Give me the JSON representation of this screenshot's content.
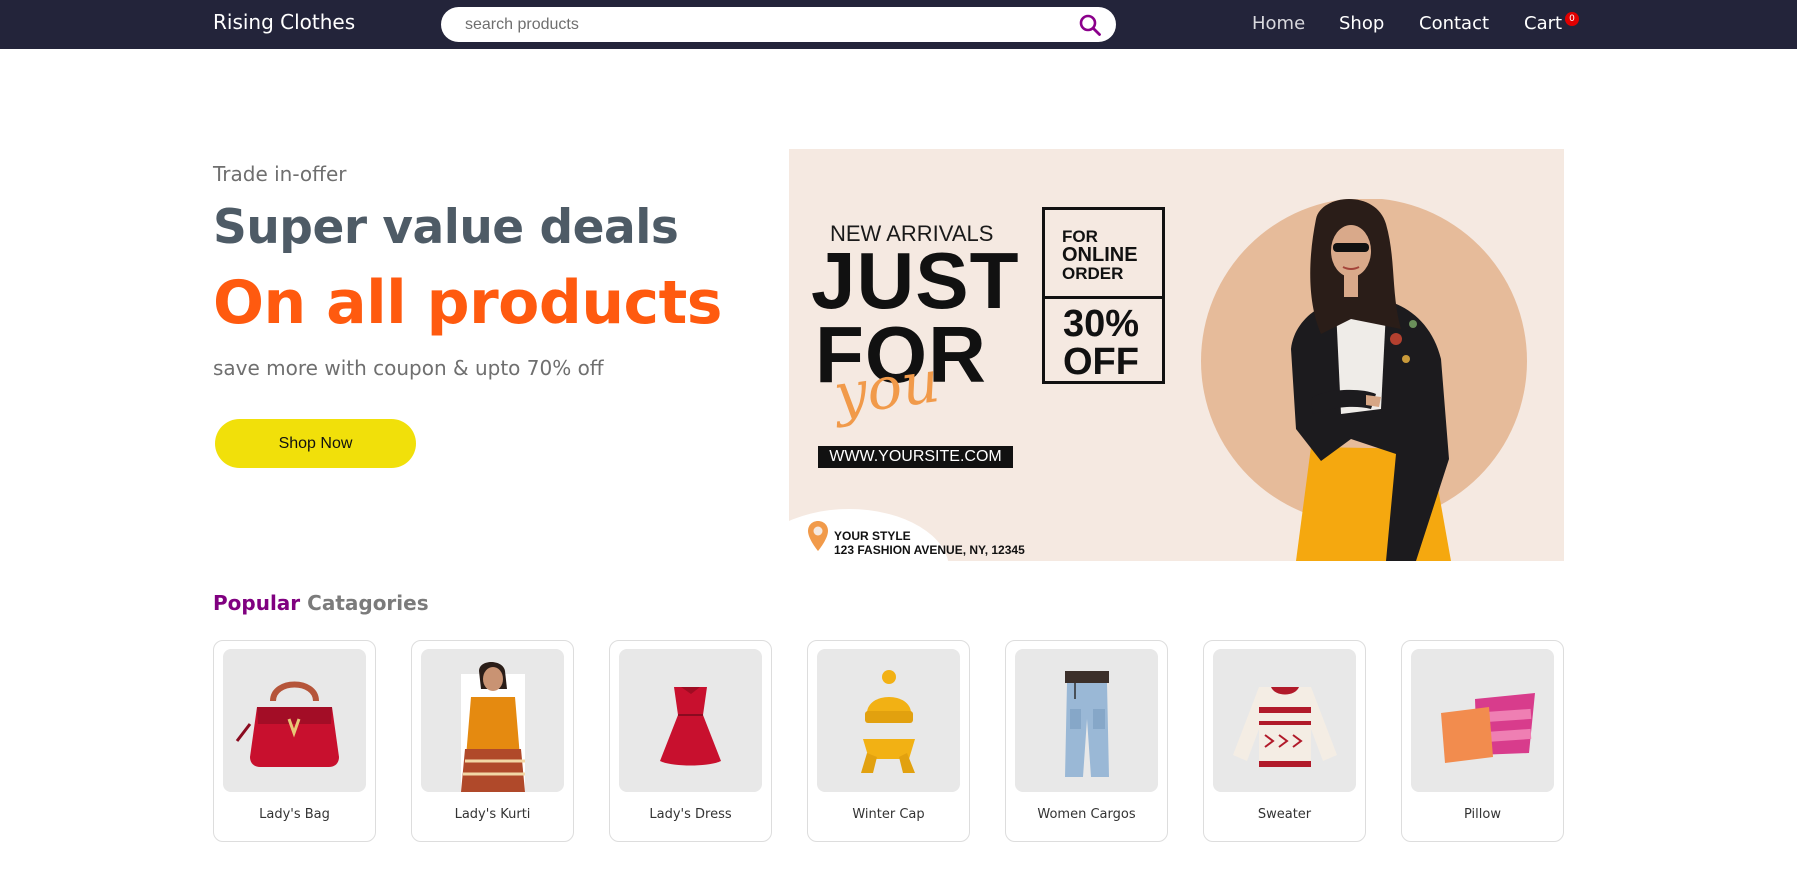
{
  "navbar": {
    "brand": "Rising Clothes",
    "search": {
      "placeholder": "search products",
      "value": ""
    },
    "links": [
      {
        "label": "Home"
      },
      {
        "label": "Shop"
      },
      {
        "label": "Contact"
      },
      {
        "label": "Cart"
      }
    ],
    "cart_count": "0"
  },
  "hero": {
    "kicker": "Trade in-offer",
    "title": "Super value deals",
    "title2": "On all products",
    "subtitle": "save more with coupon & upto 70% off",
    "cta_label": "Shop Now"
  },
  "banner": {
    "new_arrivals": "NEW ARRIVALS",
    "just": "JUST",
    "for": "FOR",
    "you": "you",
    "site": "WWW.YOURSITE.COM",
    "box_for": "FOR",
    "box_online": "ONLINE",
    "box_order": "ORDER",
    "box_pct": "30%",
    "box_off": "OFF",
    "style_line1": "YOUR STYLE",
    "style_line2": "123 FASHION AVENUE, NY, 12345"
  },
  "categories": {
    "heading_1": "Popular",
    "heading_2": "Catagories",
    "items": [
      {
        "label": "Lady's Bag",
        "icon": "handbag-image"
      },
      {
        "label": "Lady's Kurti",
        "icon": "kurti-image"
      },
      {
        "label": "Lady's Dress",
        "icon": "dress-image"
      },
      {
        "label": "Winter Cap",
        "icon": "winter-cap-image"
      },
      {
        "label": "Women Cargos",
        "icon": "cargos-image"
      },
      {
        "label": "Sweater",
        "icon": "sweater-image"
      },
      {
        "label": "Pillow",
        "icon": "pillow-image"
      }
    ]
  },
  "colors": {
    "navbar_bg": "#23243a",
    "accent_orange": "#ff5a0f",
    "cta_yellow": "#f1e00a",
    "heading_purple": "#800080",
    "cart_badge": "#e00000"
  }
}
